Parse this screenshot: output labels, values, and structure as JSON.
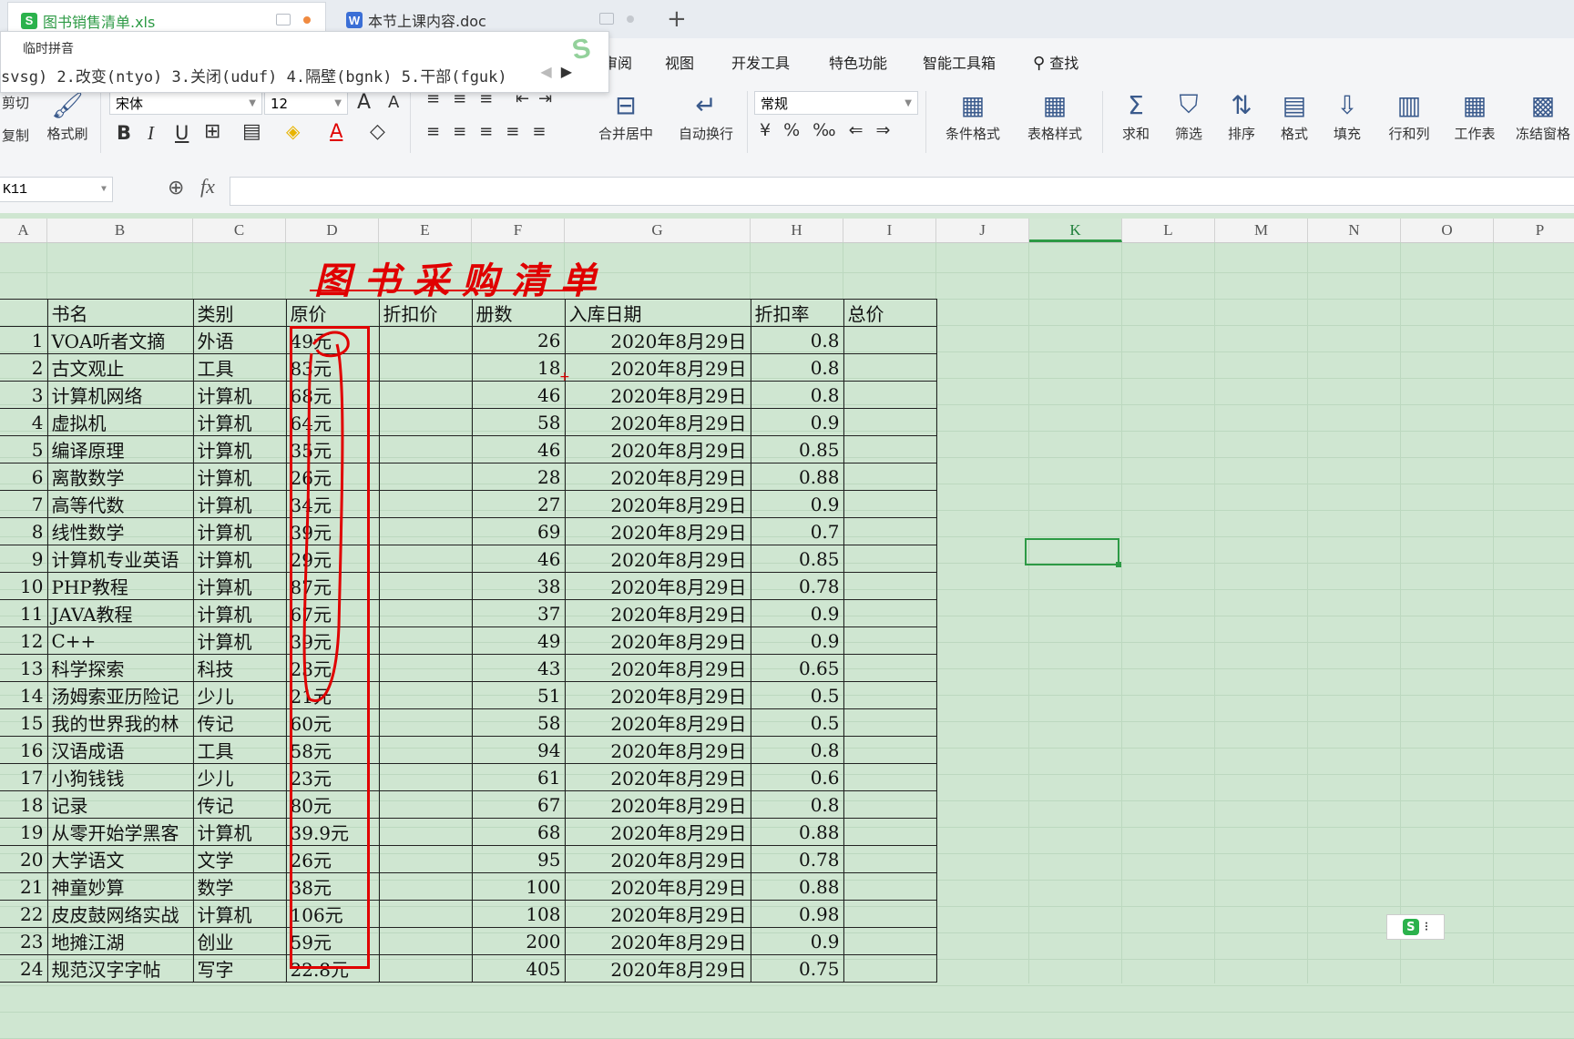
{
  "tabs": [
    {
      "title": "图书销售清单.xls",
      "icon": "S"
    },
    {
      "title": "本节上课内容.doc",
      "icon": "W"
    }
  ],
  "new_tab": "+",
  "menu": [
    "审阅",
    "视图",
    "开发工具",
    "特色功能",
    "智能工具箱",
    "查找"
  ],
  "ime": {
    "label": "临时拼音",
    "candidates": "svsg) 2.改变(ntyo) 3.关闭(uduf) 4.隔壁(bgnk) 5.干部(fguk)"
  },
  "ribbon": {
    "cut": "剪切",
    "copy": "复制",
    "format_painter": "格式刷",
    "font_name": "宋体",
    "font_size": "12",
    "grow": "A",
    "shrink": "A",
    "bold": "B",
    "italic": "I",
    "underline": "U",
    "merge_center": "合并居中",
    "wrap": "自动换行",
    "number_format": "常规",
    "cond_format": "条件格式",
    "table_style": "表格样式",
    "sum": "求和",
    "filter": "筛选",
    "sort": "排序",
    "format": "格式",
    "fill": "填充",
    "row_col": "行和列",
    "worksheet": "工作表",
    "freeze": "冻结窗格"
  },
  "formula_bar": {
    "name_box": "K11",
    "fx": "fx",
    "value": ""
  },
  "columns": [
    "A",
    "B",
    "C",
    "D",
    "E",
    "F",
    "G",
    "H",
    "I",
    "J",
    "K",
    "L",
    "M",
    "N",
    "O",
    "P"
  ],
  "selected_column": "K",
  "sheet": {
    "title": "图书采购清单",
    "headers": [
      "书名",
      "类别",
      "原价",
      "折扣价",
      "册数",
      "入库日期",
      "折扣率",
      "总价"
    ],
    "rows": [
      [
        "1",
        "VOA听者文摘",
        "外语",
        "49元",
        "",
        "26",
        "2020年8月29日",
        "0.8",
        ""
      ],
      [
        "2",
        "古文观止",
        "工具",
        "83元",
        "",
        "18",
        "2020年8月29日",
        "0.8",
        ""
      ],
      [
        "3",
        "计算机网络",
        "计算机",
        "68元",
        "",
        "46",
        "2020年8月29日",
        "0.8",
        ""
      ],
      [
        "4",
        "虚拟机",
        "计算机",
        "64元",
        "",
        "58",
        "2020年8月29日",
        "0.9",
        ""
      ],
      [
        "5",
        "编译原理",
        "计算机",
        "35元",
        "",
        "46",
        "2020年8月29日",
        "0.85",
        ""
      ],
      [
        "6",
        "离散数学",
        "计算机",
        "26元",
        "",
        "28",
        "2020年8月29日",
        "0.88",
        ""
      ],
      [
        "7",
        "高等代数",
        "计算机",
        "34元",
        "",
        "27",
        "2020年8月29日",
        "0.9",
        ""
      ],
      [
        "8",
        "线性数学",
        "计算机",
        "39元",
        "",
        "69",
        "2020年8月29日",
        "0.7",
        ""
      ],
      [
        "9",
        "计算机专业英语",
        "计算机",
        "29元",
        "",
        "46",
        "2020年8月29日",
        "0.85",
        ""
      ],
      [
        "10",
        "PHP教程",
        "计算机",
        "87元",
        "",
        "38",
        "2020年8月29日",
        "0.78",
        ""
      ],
      [
        "11",
        "JAVA教程",
        "计算机",
        "67元",
        "",
        "37",
        "2020年8月29日",
        "0.9",
        ""
      ],
      [
        "12",
        "C++",
        "计算机",
        "39元",
        "",
        "49",
        "2020年8月29日",
        "0.9",
        ""
      ],
      [
        "13",
        "科学探索",
        "科技",
        "23元",
        "",
        "43",
        "2020年8月29日",
        "0.65",
        ""
      ],
      [
        "14",
        "汤姆索亚历险记",
        "少儿",
        "21元",
        "",
        "51",
        "2020年8月29日",
        "0.5",
        ""
      ],
      [
        "15",
        "我的世界我的林",
        "传记",
        "60元",
        "",
        "58",
        "2020年8月29日",
        "0.5",
        ""
      ],
      [
        "16",
        "汉语成语",
        "工具",
        "58元",
        "",
        "94",
        "2020年8月29日",
        "0.8",
        ""
      ],
      [
        "17",
        "小狗钱钱",
        "少儿",
        "23元",
        "",
        "61",
        "2020年8月29日",
        "0.6",
        ""
      ],
      [
        "18",
        "记录",
        "传记",
        "80元",
        "",
        "67",
        "2020年8月29日",
        "0.8",
        ""
      ],
      [
        "19",
        "从零开始学黑客",
        "计算机",
        "39.9元",
        "",
        "68",
        "2020年8月29日",
        "0.88",
        ""
      ],
      [
        "20",
        "大学语文",
        "文学",
        "26元",
        "",
        "95",
        "2020年8月29日",
        "0.78",
        ""
      ],
      [
        "21",
        "神童妙算",
        "数学",
        "38元",
        "",
        "100",
        "2020年8月29日",
        "0.88",
        ""
      ],
      [
        "22",
        "皮皮鼓网络实战",
        "计算机",
        "106元",
        "",
        "108",
        "2020年8月29日",
        "0.98",
        ""
      ],
      [
        "23",
        "地摊江湖",
        "创业",
        "59元",
        "",
        "200",
        "2020年8月29日",
        "0.9",
        ""
      ],
      [
        "24",
        "规范汉字字帖",
        "写字",
        "22.8元",
        "",
        "405",
        "2020年8月29日",
        "0.75",
        ""
      ]
    ]
  },
  "colors": {
    "accent": "#2d9a45",
    "sheet_bg": "#cfe6d1",
    "annotation": "#e00000"
  }
}
